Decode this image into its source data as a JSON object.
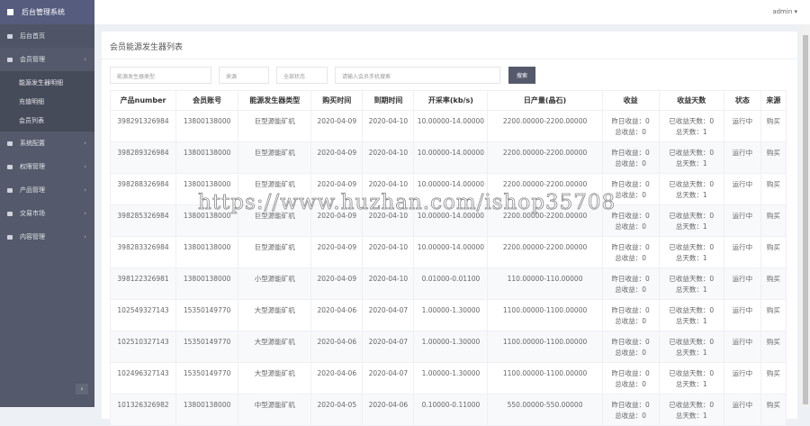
{
  "sidebar": {
    "brand": "后台管理系统",
    "items": [
      {
        "label": "后台首页"
      },
      {
        "label": "会员管理"
      },
      {
        "label": "系统配置"
      },
      {
        "label": "权限管理"
      },
      {
        "label": "产品管理"
      },
      {
        "label": "交易市场"
      },
      {
        "label": "内容管理"
      }
    ],
    "sub_items": [
      {
        "label": "能源发生器明细"
      },
      {
        "label": "充值明细"
      },
      {
        "label": "会员列表"
      }
    ],
    "collapse": "‹"
  },
  "header": {
    "user": "admin ▾"
  },
  "page": {
    "title": "会员能源发生器列表"
  },
  "filters": {
    "type": "能源发生器类型",
    "source": "来源",
    "status": "全部状态",
    "phone_placeholder": "请输入会员手机搜索",
    "search": "搜索"
  },
  "table": {
    "headers": [
      "产品number",
      "会员账号",
      "能源发生器类型",
      "购买时间",
      "到期时间",
      "开采率(kb/s)",
      "日产量(晶石)",
      "收益",
      "收益天数",
      "状态",
      "来源"
    ],
    "rows": [
      [
        "398291326984",
        "13800138000",
        "巨型源能矿机",
        "2020-04-09",
        "2020-04-10",
        "10.00000-14.00000",
        "2200.00000-2200.00000",
        "昨日收益：0",
        "总收益：0",
        "已收益天数：0",
        "总天数：1",
        "运行中",
        "购买"
      ],
      [
        "398289326984",
        "13800138000",
        "巨型源能矿机",
        "2020-04-09",
        "2020-04-10",
        "10.00000-14.00000",
        "2200.00000-2200.00000",
        "昨日收益：0",
        "总收益：0",
        "已收益天数：0",
        "总天数：1",
        "运行中",
        "购买"
      ],
      [
        "398288326984",
        "13800138000",
        "巨型源能矿机",
        "2020-04-09",
        "2020-04-10",
        "10.00000-14.00000",
        "2200.00000-2200.00000",
        "昨日收益：0",
        "总收益：0",
        "已收益天数：0",
        "总天数：1",
        "运行中",
        "购买"
      ],
      [
        "398285326984",
        "13800138000",
        "巨型源能矿机",
        "2020-04-09",
        "2020-04-10",
        "10.00000-14.00000",
        "2200.00000-2200.00000",
        "昨日收益：0",
        "总收益：0",
        "已收益天数：0",
        "总天数：1",
        "运行中",
        "购买"
      ],
      [
        "398283326984",
        "13800138000",
        "巨型源能矿机",
        "2020-04-09",
        "2020-04-10",
        "10.00000-14.00000",
        "2200.00000-2200.00000",
        "昨日收益：0",
        "总收益：0",
        "已收益天数：0",
        "总天数：1",
        "运行中",
        "购买"
      ],
      [
        "398122326981",
        "13800138000",
        "小型源能矿机",
        "2020-04-09",
        "2020-04-10",
        "0.01000-0.01100",
        "110.00000-110.00000",
        "昨日收益：0",
        "总收益：0",
        "已收益天数：0",
        "总天数：1",
        "运行中",
        "购买"
      ],
      [
        "102549327143",
        "15350149770",
        "大型源能矿机",
        "2020-04-06",
        "2020-04-07",
        "1.00000-1.30000",
        "1100.00000-1100.00000",
        "昨日收益：0",
        "总收益：0",
        "已收益天数：0",
        "总天数：1",
        "运行中",
        "购买"
      ],
      [
        "102510327143",
        "15350149770",
        "大型源能矿机",
        "2020-04-06",
        "2020-04-07",
        "1.00000-1.30000",
        "1100.00000-1100.00000",
        "昨日收益：0",
        "总收益：0",
        "已收益天数：0",
        "总天数：1",
        "运行中",
        "购买"
      ],
      [
        "102496327143",
        "15350149770",
        "大型源能矿机",
        "2020-04-06",
        "2020-04-07",
        "1.00000-1.30000",
        "1100.00000-1100.00000",
        "昨日收益：0",
        "总收益：0",
        "已收益天数：0",
        "总天数：1",
        "运行中",
        "购买"
      ],
      [
        "101326326982",
        "13800138000",
        "中型源能矿机",
        "2020-04-05",
        "2020-04-06",
        "0.10000-0.11000",
        "550.00000-550.00000",
        "昨日收益：0",
        "总收益：0",
        "已收益天数：0",
        "总天数：1",
        "运行中",
        "购买"
      ]
    ]
  },
  "watermark": "https://www.huzhan.com/ishop35708"
}
